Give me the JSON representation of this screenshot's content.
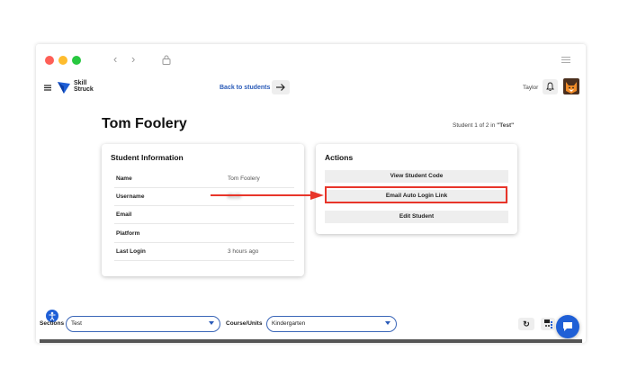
{
  "navbar": {
    "brand_line1": "Skill",
    "brand_line2": "Struck",
    "back_label": "Back to students",
    "user_name": "Taylor"
  },
  "header": {
    "title": "Tom Foolery",
    "student_counter_prefix": "Student 1 of 2  in ",
    "student_counter_section": "\"Test\""
  },
  "student_info": {
    "title": "Student Information",
    "rows": [
      {
        "label": "Name",
        "value": "Tom Foolery"
      },
      {
        "label": "Username",
        "value": "tf123"
      },
      {
        "label": "Email",
        "value": ""
      },
      {
        "label": "Platform",
        "value": ""
      },
      {
        "label": "Last Login",
        "value": "3 hours ago"
      }
    ]
  },
  "actions": {
    "title": "Actions",
    "view_code": "View Student Code",
    "email_link": "Email Auto Login Link",
    "edit": "Edit Student"
  },
  "footer": {
    "sections_label": "Sections",
    "sections_value": "Test",
    "course_label": "Course/Units",
    "course_value": "Kindergarten",
    "refresh_icon": "↻"
  },
  "colors": {
    "accent": "#2a5bb8",
    "highlight": "#e8352a",
    "traffic_red": "#fe5f57",
    "traffic_yellow": "#febc2e",
    "traffic_green": "#28c840"
  }
}
